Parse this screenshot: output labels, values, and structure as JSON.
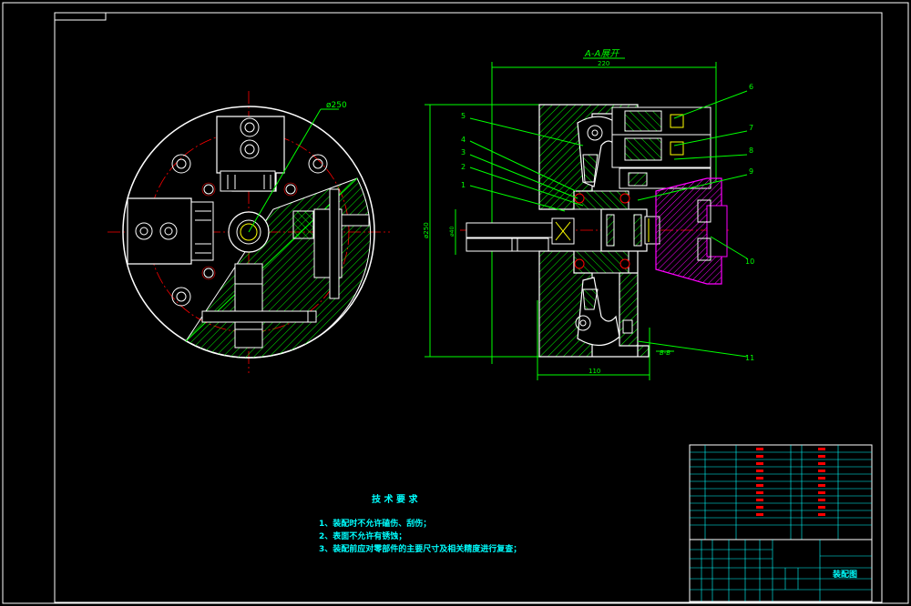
{
  "section_label": "A-A展开",
  "section_label_bottom": "B-B",
  "dims": {
    "top_width": "220",
    "bottom_width": "110",
    "diameter_label": "ø250",
    "height_label": "ø250",
    "bore_label": "ø40"
  },
  "callouts": [
    "1",
    "2",
    "3",
    "4",
    "5",
    "6",
    "7",
    "8",
    "9",
    "10",
    "11"
  ],
  "notes": {
    "title": "技 术 要 求",
    "items": [
      "1、装配时不允许磕伤、刮伤；",
      "2、表面不允许有锈蚀；",
      "3、装配前应对零部件的主要尺寸及相关精度进行复查；"
    ]
  },
  "title_block": {
    "drawing_name": "装配图"
  },
  "colors": {
    "line": "#ffffff",
    "green": "#00ff00",
    "cyan": "#00ffff",
    "red": "#ff0000",
    "magenta": "#ff00ff",
    "yellow": "#ffff00"
  }
}
